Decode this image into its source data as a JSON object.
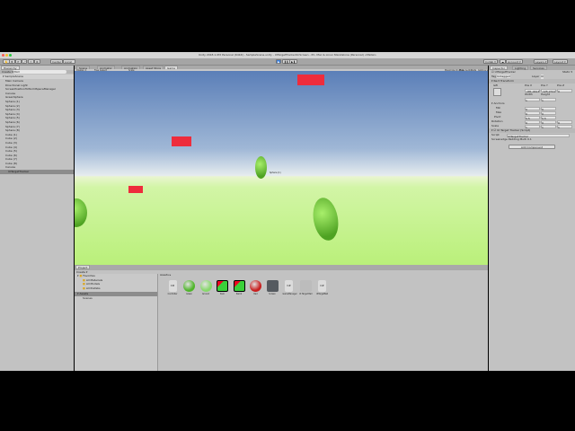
{
  "window": {
    "title": "Unity 2018.1.0f2 Personal (64bit) - SampleScene.unity - UITargetTrackerOnScreen - PC, Mac & Linux Standalone (Personal) <Metal>"
  },
  "toolbar": {
    "tools": [
      "✋",
      "✥",
      "⟳",
      "⤢",
      "▭",
      "⚙"
    ],
    "pivot": "Center",
    "space": "Local",
    "play": "▶",
    "pause": "❚❚",
    "step": "▶❚",
    "collab": "Collab ▾",
    "cloud": "☁",
    "account": "Account ▾",
    "layers": "Layers ▾",
    "layout": "Layout ▾"
  },
  "hierarchy": {
    "tab": "Hierarchy",
    "create": "Create ▾",
    "search_placeholder": "Q▾All",
    "scene": "SampleScene",
    "items": [
      "Main Camera",
      "Directional Light",
      "ScreenPositionToWorldSpaceManager",
      "Canvas",
      "GreenSphere",
      "Sphere (1)",
      "Sphere (2)",
      "Sphere (3)",
      "Sphere (4)",
      "Sphere (5)",
      "Sphere (6)",
      "Sphere (7)",
      "Sphere (8)",
      "Cube (1)",
      "Cube (2)",
      "Cube (3)",
      "Cube (4)",
      "Cube (5)",
      "Cube (6)",
      "Cube (7)",
      "Cube (8)",
      "Canvas",
      "UITargetTracker"
    ]
  },
  "center": {
    "tabs": [
      "Scene",
      "Animator",
      "Animation",
      "Asset Store",
      "Game"
    ],
    "active_tab": 4,
    "display": "Display 1",
    "aspect": "Free Aspect",
    "scale": "Scale",
    "bar_buttons": [
      "Maximize On Play",
      "Mute Audio",
      "Stats",
      "Gizmos ▾"
    ],
    "label_small": "Sphere (1)"
  },
  "project": {
    "tab": "Project",
    "create": "Create ▾",
    "favorites": "Favorites",
    "fav_items": [
      "All Materials",
      "All Models",
      "All Prefabs"
    ],
    "assets_root": "Assets",
    "asset_children": [
      "Scenes"
    ],
    "breadcrumb": "Assets ▸",
    "assets": [
      {
        "name": "Controller",
        "color": "#dcdcdc",
        "kind": "script"
      },
      {
        "name": "Green",
        "color": "#4fb52a",
        "kind": "sphere"
      },
      {
        "name": "Ground",
        "color": "#86d86a",
        "kind": "sphere"
      },
      {
        "name": "Item",
        "color": "#3ad03a",
        "kind": "tex"
      },
      {
        "name": "Item2",
        "color": "#3ad03a",
        "kind": "tex"
      },
      {
        "name": "Red",
        "color": "#c81e1e",
        "kind": "sphere"
      },
      {
        "name": "Screen",
        "color": "#555a60",
        "kind": "folder"
      },
      {
        "name": "GameManager",
        "color": "#dcdcdc",
        "kind": "script"
      },
      {
        "name": "UI Target Ball",
        "color": "#bcbcbc",
        "kind": "blank"
      },
      {
        "name": "UITargetBall",
        "color": "#dcdcdc",
        "kind": "script"
      }
    ]
  },
  "inspector": {
    "tabs": [
      "Inspector",
      "Lighting",
      "Services"
    ],
    "object_name": "UITargetTracker",
    "static": "Static ▾",
    "tag_label": "Tag",
    "tag": "Untagged",
    "layer_label": "Layer",
    "layer": "UI",
    "rect_transform": "Rect Transform",
    "anchor": "left",
    "pos_x_label": "Pos X",
    "pos_y_label": "Pos Y",
    "pos_z_label": "Pos Z",
    "pos_x": "-181.4613",
    "pos_y": "-125.2311",
    "pos_z": "0",
    "width_label": "Width",
    "height_label": "Height",
    "width": "1",
    "height": "1",
    "anchors": "Anchors",
    "min": "Min",
    "max": "Max",
    "pivot": "Pivot",
    "rotation": "Rotation",
    "scale": "Scale",
    "v0": "0",
    "v05": "0.5",
    "v1": "1",
    "script_comp": "UI Target Tracker (Script)",
    "script_label": "Script",
    "script_value": "UITargetTracker",
    "padding": "Screenedge Padding Multi 0.1",
    "add_component": "Add Component"
  }
}
